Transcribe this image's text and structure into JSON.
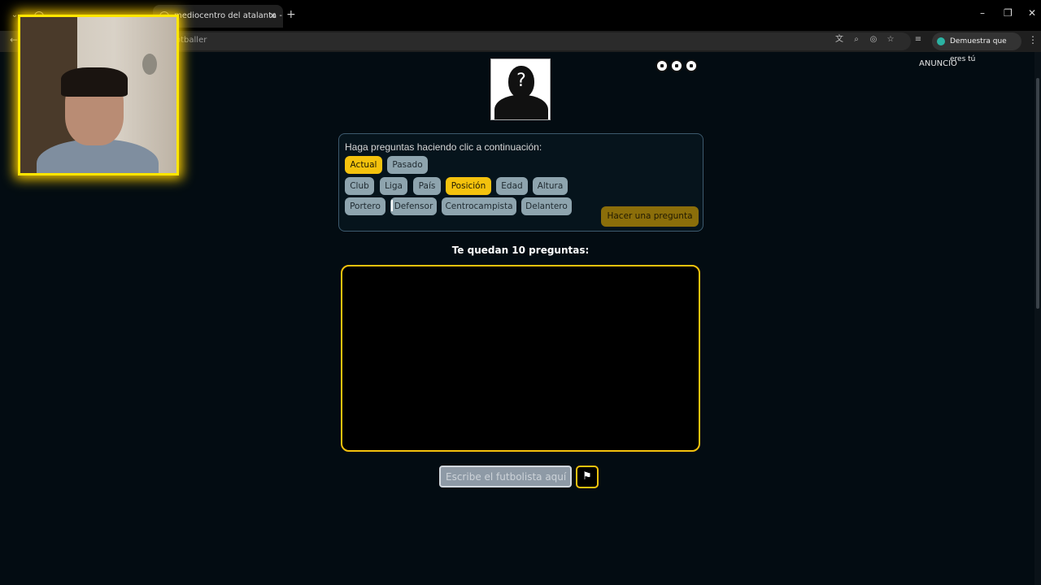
{
  "browser": {
    "tab_menu_icon": "chevron-down-icon",
    "tabs": [
      {
        "title": "",
        "active": false
      },
      {
        "title": "mediocentro del atalanta - Busc",
        "active": true
      }
    ],
    "new_tab_label": "+",
    "address_text": "otballer",
    "profile_label": "Demuestra que eres tú",
    "window_controls": [
      "–",
      "❐",
      "✕"
    ]
  },
  "page": {
    "ad_label": "ANUNCIO",
    "lives_icon": "soccer-ball-icon",
    "lives_count": 3,
    "panel_title": "Haga preguntas haciendo clic a continuación:",
    "time_chips": [
      {
        "label": "Actual",
        "selected": true
      },
      {
        "label": "Pasado",
        "selected": false
      }
    ],
    "attribute_chips": [
      {
        "label": "Club",
        "selected": false
      },
      {
        "label": "Liga",
        "selected": false
      },
      {
        "label": "País",
        "selected": false
      },
      {
        "label": "Posición",
        "selected": true
      },
      {
        "label": "Edad",
        "selected": false
      },
      {
        "label": "Altura",
        "selected": false
      }
    ],
    "position_chips": [
      {
        "label": "Portero",
        "selected": false
      },
      {
        "label": "Defensor",
        "selected": false
      },
      {
        "label": "Centrocampista",
        "selected": false
      },
      {
        "label": "Delantero",
        "selected": false
      }
    ],
    "ask_button": "Hacer una pregunta",
    "remaining_text": "Te quedan 10 preguntas:",
    "guess_placeholder": "Escribe el futbolista aquí",
    "flag_icon": "flag-icon",
    "accent_color": "#f4c20d"
  }
}
